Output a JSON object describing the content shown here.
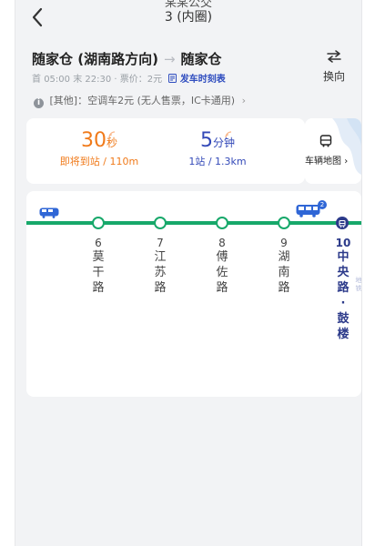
{
  "header": {
    "title_cut": "某某公交",
    "title": "3 (内圈)"
  },
  "route": {
    "from": "随家仓 (湖南路方向)",
    "arrow": "→",
    "to": "随家仓",
    "swap_label": "换向",
    "first_label": "首",
    "first_time": "05:00",
    "last_label": "末",
    "last_time": "22:30",
    "fare_label": "票价：",
    "fare": "2元",
    "schedule_label": "发车时刻表"
  },
  "notice": {
    "text": "[其他]：空调车2元 (无人售票，IC卡通用)",
    "chevron": "›"
  },
  "arrivals": [
    {
      "value": "30",
      "unit": "秒",
      "detail": "即将到站 / 110m",
      "color": "#f07a1a"
    },
    {
      "value": "5",
      "unit": "分钟",
      "detail": "1站 / 1.3km",
      "color": "#3349b8"
    }
  ],
  "map_card": {
    "label": "车辆地图",
    "chevron": "›"
  },
  "stations": [
    {
      "num": "6",
      "name": "莫干路"
    },
    {
      "num": "7",
      "name": "江苏路"
    },
    {
      "num": "8",
      "name": "傅佐路"
    },
    {
      "num": "9",
      "name": "湖南路"
    }
  ],
  "current_station": {
    "num": "10",
    "name": "中央路·鼓楼"
  },
  "bus_badge": "2",
  "side_tags": [
    "地铁",
    "公交"
  ],
  "colors": {
    "line": "#17a86a",
    "accent_orange": "#f07a1a",
    "accent_blue": "#3349b8",
    "current": "#2c3a8a"
  }
}
